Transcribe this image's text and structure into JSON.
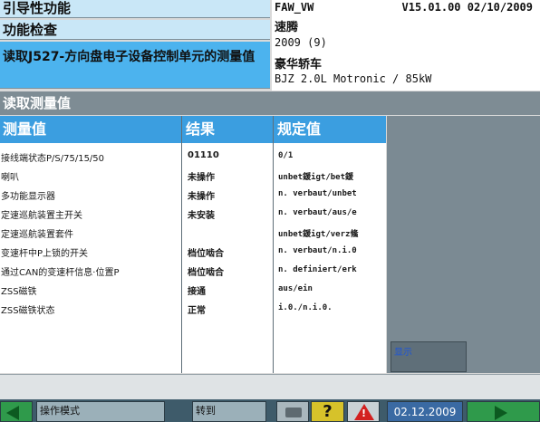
{
  "header": {
    "breadcrumb_1": "引导性功能",
    "breadcrumb_2": "功能检查",
    "current_function": "读取J527-方向盘电子设备控制单元的测量值",
    "vehicle": {
      "brand": "FAW_VW",
      "version_date": "V15.01.00 02/10/2009",
      "model": "速腾",
      "year": "2009 (9)",
      "body": "豪华轿车",
      "engine": "BJZ 2.0L Motronic / 85kW"
    }
  },
  "section_title": "读取测量值",
  "table": {
    "columns": [
      "测量值",
      "结果",
      "规定值"
    ],
    "rows": [
      {
        "name": "接线端状态P/S/75/15/50",
        "result": "01110",
        "spec": "0/1"
      },
      {
        "name": "喇叭",
        "result": "未操作",
        "spec": "unbet鍰igt/bet鍰"
      },
      {
        "name": "多功能显示器",
        "result": "未操作",
        "spec": "n. verbaut/unbet"
      },
      {
        "name": "定速巡航装置主开关",
        "result": "未安装",
        "spec": "n. verbaut/aus/e"
      },
      {
        "name": "定速巡航装置套件",
        "result": "",
        "spec": "unbet鍰igt/verz鯈"
      },
      {
        "name": "变速杆中P上锁的开关",
        "result": "档位啮合",
        "spec": "n. verbaut/n.i.0"
      },
      {
        "name": "通过CAN的变速杆信息·位置P",
        "result": "档位啮合",
        "spec": "n. definiert/erk"
      },
      {
        "name": "ZSS磁铁",
        "result": "接通",
        "spec": "aus/ein"
      },
      {
        "name": "ZSS磁铁状态",
        "result": "正常",
        "spec": "i.0./n.i.0."
      }
    ]
  },
  "side_field": "显示",
  "toolbar": {
    "mode_label": "操作模式",
    "goto_label": "转到",
    "help_label": "?",
    "date": "02.12.2009",
    "back_icon": "arrow-left-icon",
    "next_icon": "arrow-right-icon",
    "print_icon": "printer-icon",
    "warn_icon": "warning-icon"
  },
  "colors": {
    "header_light": "#c9e7f7",
    "header_active": "#4cb3ee",
    "table_head": "#3b9ee0",
    "section_bar": "#7e8c94",
    "toolbar": "#3e5b6a"
  }
}
